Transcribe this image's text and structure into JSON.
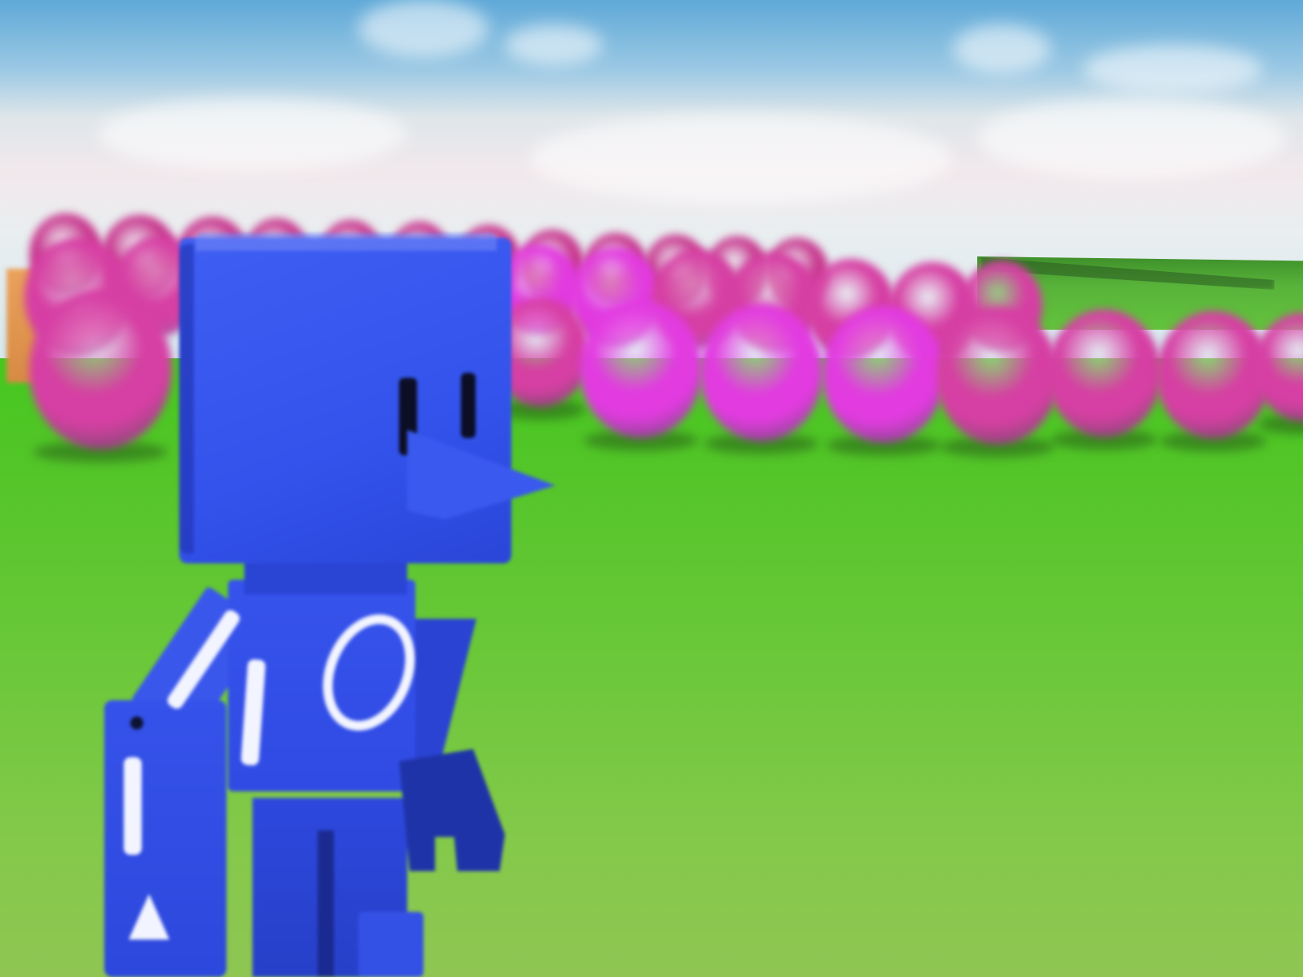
{
  "scene": {
    "type": "3d-game-view",
    "sky_color": "#dfe6ea",
    "ground_color": "#6cc83a",
    "balloon_colors": [
      "#d63fa3",
      "#e23be0",
      "#c83a8f"
    ]
  },
  "character": {
    "body_color": "#3353ec",
    "marking_color": "#f2f4ff",
    "markings": [
      "ring-symbol",
      "bar-symbol",
      "triangle-symbol"
    ]
  }
}
